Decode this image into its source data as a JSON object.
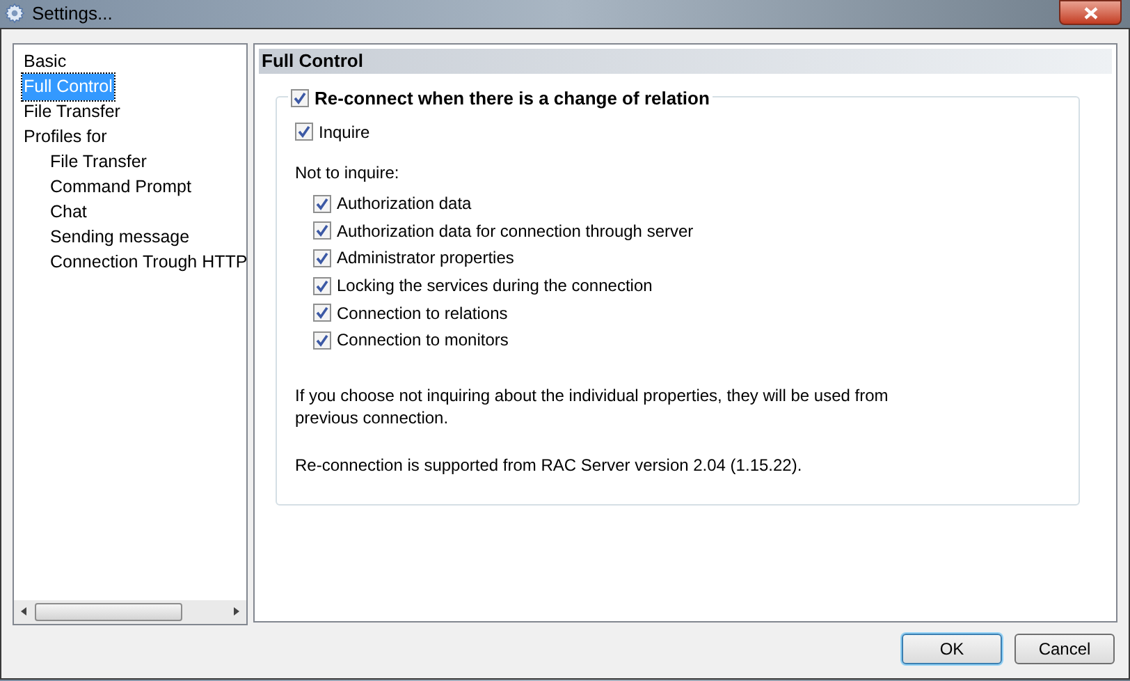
{
  "window": {
    "title": "Settings..."
  },
  "tree": [
    {
      "label": "Basic",
      "selected": false
    },
    {
      "label": "Full Control",
      "selected": true
    },
    {
      "label": "File Transfer",
      "selected": false
    },
    {
      "label": "Profiles for",
      "selected": false,
      "children": [
        {
          "label": "File Transfer",
          "selected": false
        },
        {
          "label": "Command Prompt",
          "selected": false
        },
        {
          "label": "Chat",
          "selected": false
        },
        {
          "label": "Sending message",
          "selected": false
        },
        {
          "label": "Connection Trough HTTP",
          "selected": false
        }
      ]
    }
  ],
  "panel": {
    "title": "Full Control",
    "group": {
      "label": "Re-connect when there is a change of relation",
      "checked": true
    },
    "inquire": {
      "label": "Inquire",
      "checked": true
    },
    "not_to_inquire": "Not to inquire:",
    "options": [
      {
        "label": "Authorization data",
        "checked": true
      },
      {
        "label": "Authorization data for connection through server",
        "checked": true
      },
      {
        "label": "Administrator properties",
        "checked": true
      },
      {
        "label": "Locking the services during the connection",
        "checked": true
      },
      {
        "label": "Connection to relations",
        "checked": true
      },
      {
        "label": "Connection to monitors",
        "checked": true
      }
    ],
    "notes": [
      "If you choose not inquiring about the individual properties, they will be used from previous connection.",
      "Re-connection is supported from RAC Server version 2.04 (1.15.22)."
    ]
  },
  "buttons": [
    {
      "label": "OK",
      "default": true
    },
    {
      "label": "Cancel",
      "default": false
    }
  ]
}
